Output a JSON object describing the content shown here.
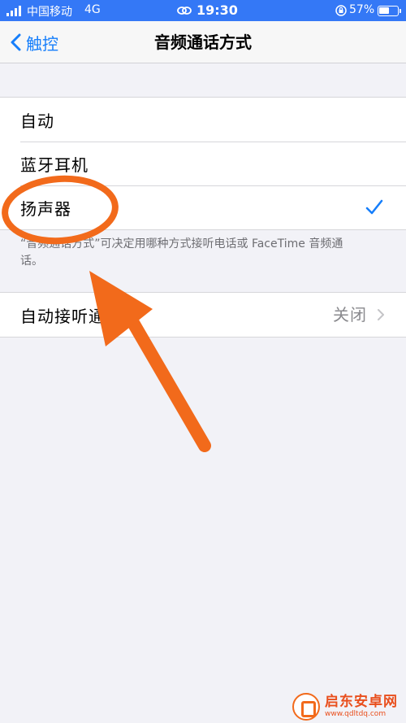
{
  "status_bar": {
    "carrier": "中国移动",
    "network": "4G",
    "time": "19:30",
    "battery_percent": "57%",
    "battery_level": 0.57
  },
  "nav": {
    "back_label": "触控",
    "title": "音频通话方式"
  },
  "audio_options": [
    {
      "label": "自动",
      "selected": false
    },
    {
      "label": "蓝牙耳机",
      "selected": false
    },
    {
      "label": "扬声器",
      "selected": true
    }
  ],
  "footnote": "“音频通话方式”可决定用哪种方式接听电话或 FaceTime 音频通话。",
  "auto_answer": {
    "label": "自动接听通话",
    "value": "关闭"
  },
  "watermark": {
    "title": "启东安卓网",
    "url": "www.qdltdq.com"
  },
  "colors": {
    "accent": "#157efb",
    "annotation": "#f26a1b",
    "status_bar": "#3478f6"
  }
}
